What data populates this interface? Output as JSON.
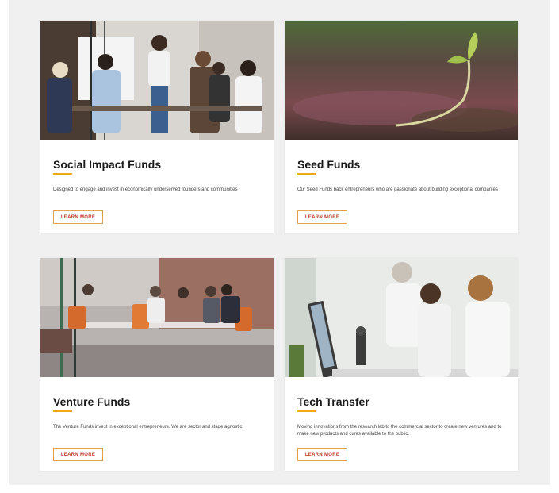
{
  "cards": [
    {
      "title": "Social Impact Funds",
      "description": "Designed to engage and invest in economically underserved founders and communities",
      "button": "LEARN MORE"
    },
    {
      "title": "Seed Funds",
      "description": "Our Seed Funds back entrepreneurs who are passionate about building exceptional companies",
      "button": "LEARN MORE"
    },
    {
      "title": "Venture Funds",
      "description": "The Venture Funds invest in exceptional entrepreneurs. We are sector and stage agnostic.",
      "button": "LEARN MORE"
    },
    {
      "title": "Tech Transfer",
      "description": "Moving innovations from the research lab to the commercial sector to create new ventures and to make new products and cures available to the public.",
      "button": "LEARN MORE"
    }
  ],
  "colors": {
    "accent": "#f0a91b",
    "button_text": "#c0392b",
    "button_border": "#e0a24a",
    "panel_bg": "#f0f0f0"
  }
}
